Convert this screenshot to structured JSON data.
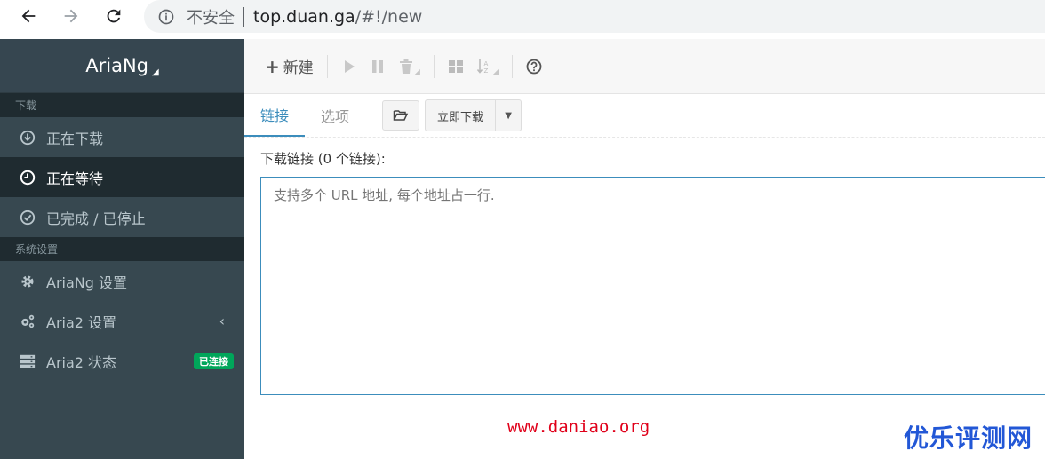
{
  "browser": {
    "insecure_label": "不安全",
    "url_host": "top.duan.ga",
    "url_path": "/#!/new"
  },
  "sidebar": {
    "brand": "AriaNg",
    "section_download": "下载",
    "items_download": [
      {
        "label": "正在下载",
        "icon": "download-circle-icon"
      },
      {
        "label": "正在等待",
        "icon": "clock-icon"
      },
      {
        "label": "已完成 / 已停止",
        "icon": "check-circle-icon"
      }
    ],
    "section_settings": "系统设置",
    "items_settings": [
      {
        "label": "AriaNg 设置",
        "icon": "gear-icon"
      },
      {
        "label": "Aria2 设置",
        "icon": "gears-icon"
      },
      {
        "label": "Aria2 状态",
        "icon": "server-icon"
      }
    ],
    "status_badge": "已连接"
  },
  "toolbar": {
    "new_label": "新建"
  },
  "tabs": {
    "links": "链接",
    "options": "选项",
    "download_now": "立即下载"
  },
  "form": {
    "label": "下载链接 (0 个链接):",
    "placeholder": "支持多个 URL 地址, 每个地址占一行."
  },
  "watermarks": {
    "site": "www.daniao.org",
    "brand": "优乐评测网"
  },
  "colors": {
    "sidebar_bg": "#374850",
    "sidebar_active": "#1f2b30",
    "accent": "#3c8dbc",
    "badge": "#00a65a"
  }
}
